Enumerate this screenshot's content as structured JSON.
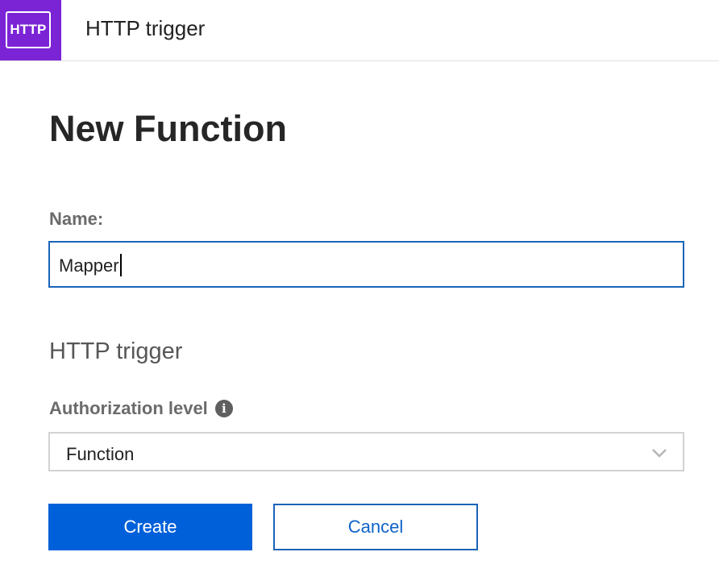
{
  "header": {
    "logo_text": "HTTP",
    "title": "HTTP trigger",
    "logo_color": "#7b24d6"
  },
  "main": {
    "page_title": "New Function",
    "name_label": "Name:",
    "name_value": "Mapper",
    "section_title": "HTTP trigger",
    "auth_label": "Authorization level",
    "info_icon": "info-icon",
    "auth_selected": "Function"
  },
  "buttons": {
    "create_label": "Create",
    "cancel_label": "Cancel",
    "accent_color": "#0060d9"
  }
}
